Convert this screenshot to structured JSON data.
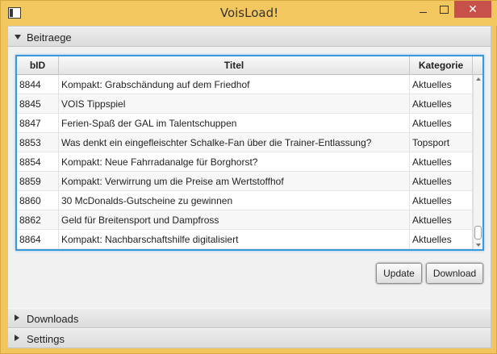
{
  "window": {
    "title": "VoisLoad!",
    "close_glyph": "✕"
  },
  "accordion": {
    "beitraege_label": "Beitraege",
    "downloads_label": "Downloads",
    "settings_label": "Settings"
  },
  "table": {
    "columns": [
      "bID",
      "Titel",
      "Kategorie"
    ],
    "rows": [
      {
        "bid": "8844",
        "titel": "Kompakt: Grabschändung auf dem Friedhof",
        "kategorie": "Aktuelles"
      },
      {
        "bid": "8845",
        "titel": "VOIS Tippspiel",
        "kategorie": "Aktuelles"
      },
      {
        "bid": "8847",
        "titel": "Ferien-Spaß der GAL im Talentschuppen",
        "kategorie": "Aktuelles"
      },
      {
        "bid": "8853",
        "titel": "Was denkt ein eingefleischter Schalke-Fan über die Trainer-Entlassung?",
        "kategorie": "Topsport"
      },
      {
        "bid": "8854",
        "titel": "Kompakt: Neue Fahrradanalge für Borghorst?",
        "kategorie": "Aktuelles"
      },
      {
        "bid": "8859",
        "titel": "Kompakt: Verwirrung um die Preise am Wertstoffhof",
        "kategorie": "Aktuelles"
      },
      {
        "bid": "8860",
        "titel": "30 McDonalds-Gutscheine zu gewinnen",
        "kategorie": "Aktuelles"
      },
      {
        "bid": "8862",
        "titel": "Geld für Breitensport und Dampfross",
        "kategorie": "Aktuelles"
      },
      {
        "bid": "8864",
        "titel": "Kompakt: Nachbarschaftshilfe digitalisiert",
        "kategorie": "Aktuelles"
      }
    ]
  },
  "buttons": {
    "update_label": "Update",
    "download_label": "Download"
  },
  "colors": {
    "accent": "#3a9ad9",
    "titlebar": "#f3c760",
    "close": "#c7504b"
  }
}
